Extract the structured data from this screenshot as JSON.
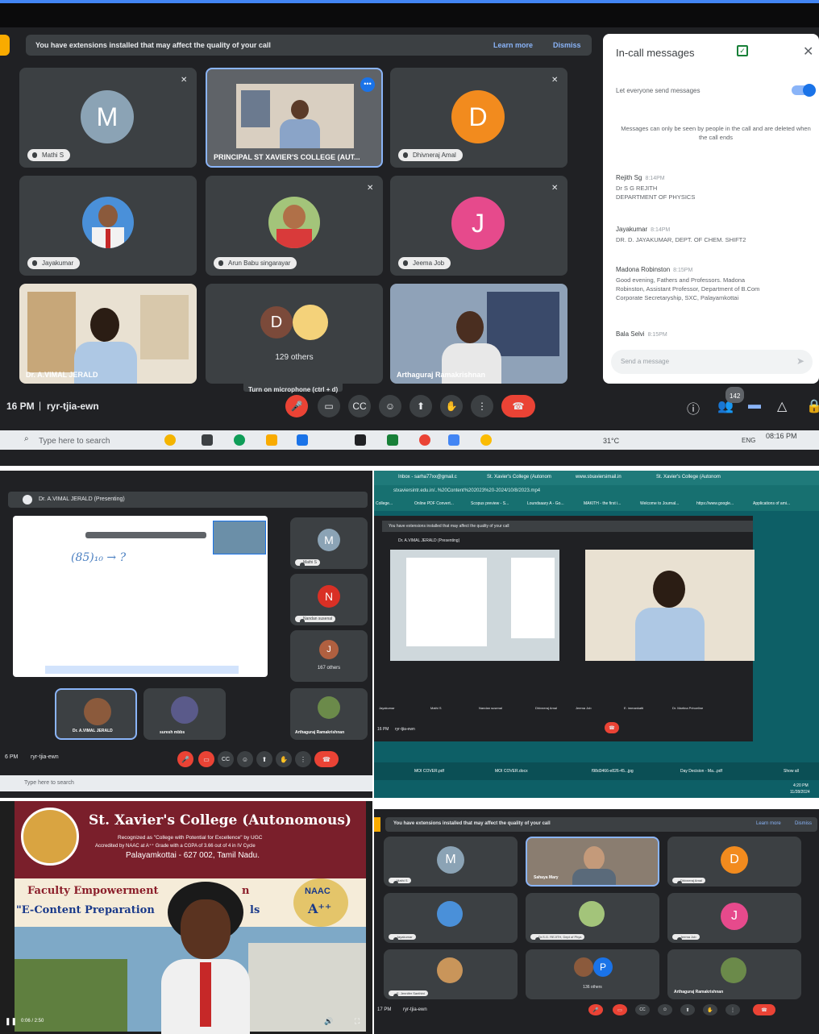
{
  "top": {
    "banner": {
      "text": "You have extensions installed that may affect the quality of your call",
      "learn_more": "Learn more",
      "dismiss": "Dismiss"
    },
    "tiles": [
      {
        "name": "Mathi S",
        "letter": "M",
        "color": "#8ba3b5"
      },
      {
        "name": "PRINCIPAL ST XAVIER'S COLLEGE (AUT..."
      },
      {
        "name": "Dhivneraj Amal",
        "letter": "D",
        "color": "#f28b1e"
      },
      {
        "name": "Jayakumar"
      },
      {
        "name": "Arun Babu singarayar"
      },
      {
        "name": "Jeema Job",
        "letter": "J",
        "color": "#e64a8c"
      },
      {
        "name": "Dr. A.VIMAL JERALD"
      },
      {
        "others_letter": "D",
        "others_label": "129 others"
      },
      {
        "name": "Arthaguraj Ramakrishnan"
      }
    ],
    "tooltip": "Turn on microphone (ctrl + d)",
    "time": "16 PM",
    "meeting_code": "ryr-tjia-ewn",
    "people_count": "142",
    "taskbar": {
      "search": "Type here to search",
      "temp": "31°C",
      "lang": "ENG",
      "clock": "08:16 PM"
    },
    "chat": {
      "title": "In-call messages",
      "toggle_label": "Let everyone send messages",
      "notice": "Messages can only be seen by people in the call and are deleted when the call ends",
      "messages": [
        {
          "name": "Rejith Sg",
          "time": "8:14PM",
          "lines": [
            "Dr S G REJITH",
            "DEPARTMENT OF PHYSICS"
          ]
        },
        {
          "name": "Jayakumar",
          "time": "8:14PM",
          "lines": [
            "DR. D. JAYAKUMAR, DEPT. OF CHEM. SHIFT2"
          ]
        },
        {
          "name": "Madona Robinston",
          "time": "8:15PM",
          "lines": [
            "Good evening, Fathers and Professors. Madona",
            "Robinston, Assistant Professor, Department of B.Com",
            "Corporate Secretaryship, SXC, Palayamkottai"
          ]
        },
        {
          "name": "Bala Selvi",
          "time": "8:15PM",
          "lines": []
        }
      ],
      "input_placeholder": "Send a message"
    }
  },
  "mid_left": {
    "presenter": "Dr. A.VIMAL JERALD (Presenting)",
    "formula": "(85)₁₀ → ?",
    "tiles": [
      {
        "name": "Mathi S",
        "letter": "M"
      },
      {
        "name": "Nandan susenal",
        "letter": "N"
      },
      {
        "letter": "J",
        "label": "167 others"
      },
      {
        "name": "Dr. A.VIMAL JERALD"
      },
      {
        "name": "suresh mbbs"
      },
      {
        "name": "Arthaguraj Ramakrishnan"
      }
    ],
    "time": "6 PM",
    "meeting_code": "ryr-tjia-ewn",
    "search": "Type here to search"
  },
  "mid_right": {
    "tabs": [
      "Inbox - sarha77xx@gmail.c",
      "St. Xavier's College (Autonom",
      "www.stxaviersimail.in",
      "St. Xavier's College (Autonom"
    ],
    "url": "stxaviersintr.edu.in/..%20Content%202023%20-2024/10/8/2023.mp4",
    "bookmarks": [
      "College...",
      "Online PDF Convert...",
      "Scopus preview - S...",
      "Loundsaary A - Go...",
      "MAKITH - the first i...",
      "Welcome to Journal...",
      "https://www.google...",
      "Applications of ami..."
    ],
    "banner": "You have extensions installed that may affect the quality of your call",
    "presenter": "Dr. A.VIMAL JERALD (Presenting)",
    "strip": [
      "Jayakumar",
      "Mathi S",
      "Nandan susenal",
      "Dhivneraj Amal",
      "Jeema Job",
      "E. immankatti",
      "Dr. Martina Princeline"
    ],
    "time": "16 PM",
    "meeting_code": "ryr-tjia-ewn",
    "downloads": [
      "MOI COVER.pdf",
      "MOI COVER.docx",
      "f98d3466-e826-45...jpg",
      "Day Decision - Ma...pdf"
    ],
    "show_all": "Show all",
    "clock": "4:20 PM",
    "date": "11/28/2024"
  },
  "bottom_left": {
    "college": "St. Xavier's College (Autonomous)",
    "line1": "Recognized as \"College with Potential for Excellence\" by UGC",
    "line2": "Accredited by NAAC at A⁺⁺ Grade with a CGPA of 3.66 out of 4 in IV Cycle",
    "line3": "Palayamkottai - 627 002, Tamil Nadu.",
    "program1": "Faculty Empowerment",
    "program1_end": "n",
    "program2": "\"E-Content Preparation",
    "program2_end": "ls",
    "naac": "NAAC",
    "naac_grade": "A⁺⁺",
    "video_time": "0:06 / 2:50"
  },
  "bottom_right": {
    "banner": "You have extensions installed that may affect the quality of your call",
    "learn_more": "Learn more",
    "dismiss": "Dismiss",
    "tiles": [
      {
        "name": "Mathi S",
        "letter": "M"
      },
      {
        "name": "Sahaya Mary"
      },
      {
        "name": "Dhivneraj Amal",
        "letter": "D"
      },
      {
        "name": "Jayakumar"
      },
      {
        "name": "Dr.S.G. REJITH, Dept of Phys"
      },
      {
        "name": "Jeema Job",
        "letter": "J"
      },
      {
        "name": "E. Jennifer Santhini"
      },
      {
        "letter": "P",
        "label": "136 others"
      },
      {
        "name": "Arthaguraj Ramakrishnan"
      }
    ],
    "time": "17 PM",
    "meeting_code": "ryr-tjia-ewn"
  }
}
